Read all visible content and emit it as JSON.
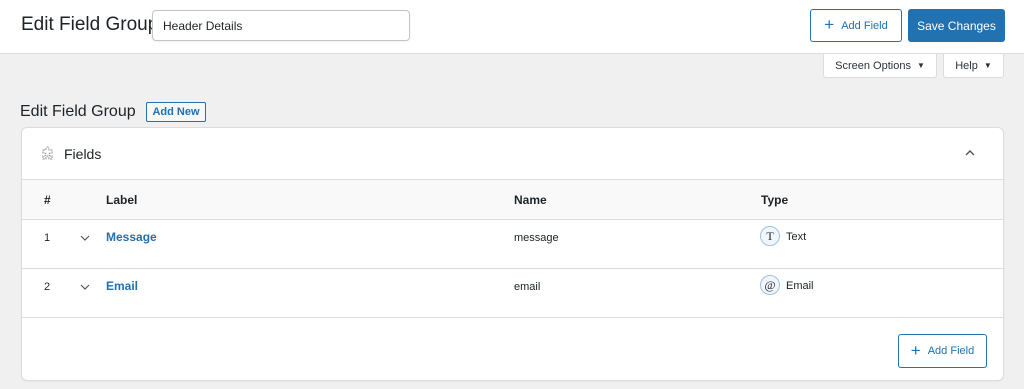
{
  "header": {
    "title": "Edit Field Group",
    "group_title_value": "Header Details",
    "add_field_label": "Add Field",
    "save_label": "Save Changes"
  },
  "screen_meta": {
    "screen_options_label": "Screen Options",
    "help_label": "Help"
  },
  "page": {
    "title": "Edit Field Group",
    "add_new_label": "Add New"
  },
  "fields_box": {
    "title": "Fields",
    "columns": [
      "#",
      "Label",
      "Name",
      "Type"
    ],
    "rows": [
      {
        "order": "1",
        "label": "Message",
        "name": "message",
        "type": "Text",
        "type_icon": "T"
      },
      {
        "order": "2",
        "label": "Email",
        "name": "email",
        "type": "Email",
        "type_icon": "@"
      }
    ],
    "add_field_label": "Add Field"
  },
  "colors": {
    "accent": "#2271b1",
    "background": "#f0f0f1"
  }
}
